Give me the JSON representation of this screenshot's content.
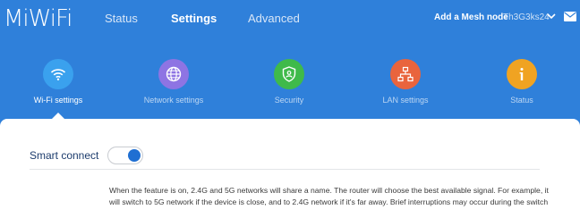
{
  "header": {
    "logo": "MiWiFi",
    "nav": [
      {
        "label": "Status",
        "active": false
      },
      {
        "label": "Settings",
        "active": true
      },
      {
        "label": "Advanced",
        "active": false
      }
    ],
    "mesh_link": "Add a Mesh node",
    "device_name": "Th3G3ks24",
    "chevron_icon": "chevron-down-icon",
    "mail_icon": "mail-icon"
  },
  "categories": [
    {
      "label": "Wi-Fi settings",
      "icon": "wifi-icon",
      "color": "#3aa1ee",
      "active": true
    },
    {
      "label": "Network settings",
      "icon": "globe-icon",
      "color": "#8e74e3",
      "active": false
    },
    {
      "label": "Security",
      "icon": "shield-icon",
      "color": "#3fba4a",
      "active": false
    },
    {
      "label": "LAN settings",
      "icon": "network-icon",
      "color": "#e9643d",
      "active": false
    },
    {
      "label": "Status",
      "icon": "info-icon",
      "color": "#f0a322",
      "active": false
    }
  ],
  "smart_connect": {
    "label": "Smart connect",
    "enabled": true,
    "description": "When the feature is on, 2.4G and 5G networks will share a name. The router will choose the best available signal. For example, it will switch to 5G network if the device is close, and to 2.4G network if it's far away. Brief interruptions may occur during the switch"
  },
  "colors": {
    "brand_blue": "#2f80da",
    "toggle_on": "#1f6fd2"
  }
}
